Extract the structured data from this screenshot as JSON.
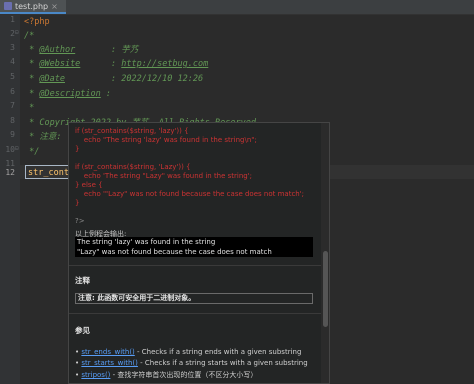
{
  "tab": {
    "label": "test.php"
  },
  "line_numbers": [
    "1",
    "2",
    "3",
    "4",
    "5",
    "6",
    "7",
    "8",
    "9",
    "10",
    "11",
    "12"
  ],
  "code": {
    "l1": "<?php",
    "l2": "/*",
    "l3_pre": " * ",
    "l3_tag": "@Author",
    "l3_post": "       : 芋艿",
    "l4_pre": " * ",
    "l4_tag": "@Website",
    "l4_mid": "      : ",
    "l4_url": "http://setbug.com",
    "l5_pre": " * ",
    "l5_tag": "@Date",
    "l5_post": "         : 2022/12/10 12:26",
    "l6_pre": " * ",
    "l6_tag": "@Description",
    "l6_post": " :",
    "l7": " *",
    "l8": " * Copyright 2022 by 芋艿, All Rights Reserved.",
    "l9": " * 注意: ",
    "l10": " */",
    "l12": "str_conta"
  },
  "popup": {
    "code_lines": [
      {
        "text": "if (str_contains($string, 'lazy')) {",
        "color": "#cc3333"
      },
      {
        "text": "    echo \"The string 'lazy' was found in the string\\n\";",
        "color": "#cc3333"
      },
      {
        "text": "}",
        "color": "#cc3333"
      },
      {
        "text": "",
        "color": "#cc3333"
      },
      {
        "text": "if (str_contains($string, 'Lazy')) {",
        "color": "#cc3333"
      },
      {
        "text": "    echo 'The string \"Lazy\" was found in the string';",
        "color": "#cc3333"
      },
      {
        "text": "} else {",
        "color": "#cc3333"
      },
      {
        "text": "    echo '\"Lazy\" was not found because the case does not match';",
        "color": "#cc3333"
      },
      {
        "text": "}",
        "color": "#cc3333"
      },
      {
        "text": "",
        "color": "#cc3333"
      },
      {
        "text": "?>",
        "color": "#8a8a8a"
      }
    ],
    "output_label": "以上例程会输出:",
    "output_lines": [
      "The string 'lazy' was found in the string",
      "\"Lazy\" was not found because the case does not match"
    ],
    "notes_heading": "注释",
    "note_text": "注意: 此函数可安全用于二进制对象。",
    "see_also_heading": "参见",
    "see_also": [
      {
        "link": "str_ends_with()",
        "desc": " - Checks if a string ends with a given substring"
      },
      {
        "link": "str_starts_with()",
        "desc": " - Checks if a string starts with a given substring"
      },
      {
        "link": "stripos()",
        "desc": " - 查找字符串首次出现的位置（不区分大小写）"
      }
    ]
  },
  "colors": {
    "editor_bg": "#2b2b2b",
    "gutter_bg": "#313335",
    "comment": "#629755",
    "keyword": "#cc7832",
    "popup_bg": "#232525",
    "link": "#589df6"
  }
}
